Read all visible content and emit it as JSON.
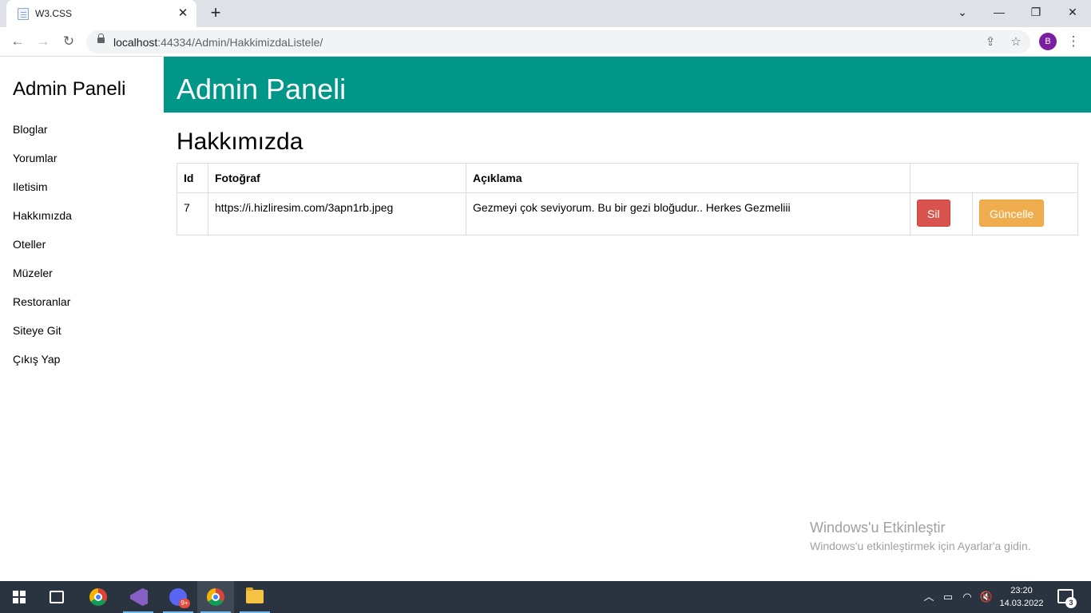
{
  "browser": {
    "tab_title": "W3.CSS",
    "url_host": "localhost",
    "url_rest": ":44334/Admin/HakkimizdaListele/",
    "profile_initial": "B"
  },
  "sidebar": {
    "title": "Admin Paneli",
    "items": [
      "Bloglar",
      "Yorumlar",
      "Iletisim",
      "Hakkımızda",
      "Oteller",
      "Müzeler",
      "Restoranlar",
      "Siteye Git",
      "Çıkış Yap"
    ]
  },
  "header": {
    "title": "Admin Paneli"
  },
  "section": {
    "title": "Hakkımızda"
  },
  "table": {
    "columns": [
      "Id",
      "Fotoğraf",
      "Açıklama",
      ""
    ],
    "rows": [
      {
        "id": "7",
        "photo": "https://i.hizliresim.com/3apn1rb.jpeg",
        "description": "Gezmeyi çok seviyorum. Bu bir gezi bloğudur.. Herkes Gezmeliii",
        "delete_label": "Sil",
        "update_label": "Güncelle"
      }
    ]
  },
  "watermark": {
    "line1": "Windows'u Etkinleştir",
    "line2": "Windows'u etkinleştirmek için Ayarlar'a gidin."
  },
  "taskbar": {
    "time": "23:20",
    "date": "14.03.2022",
    "discord_badge": "9+",
    "notification_count": "3"
  },
  "colors": {
    "header": "#009688",
    "delete": "#d9534f",
    "update": "#f0ad4e"
  }
}
